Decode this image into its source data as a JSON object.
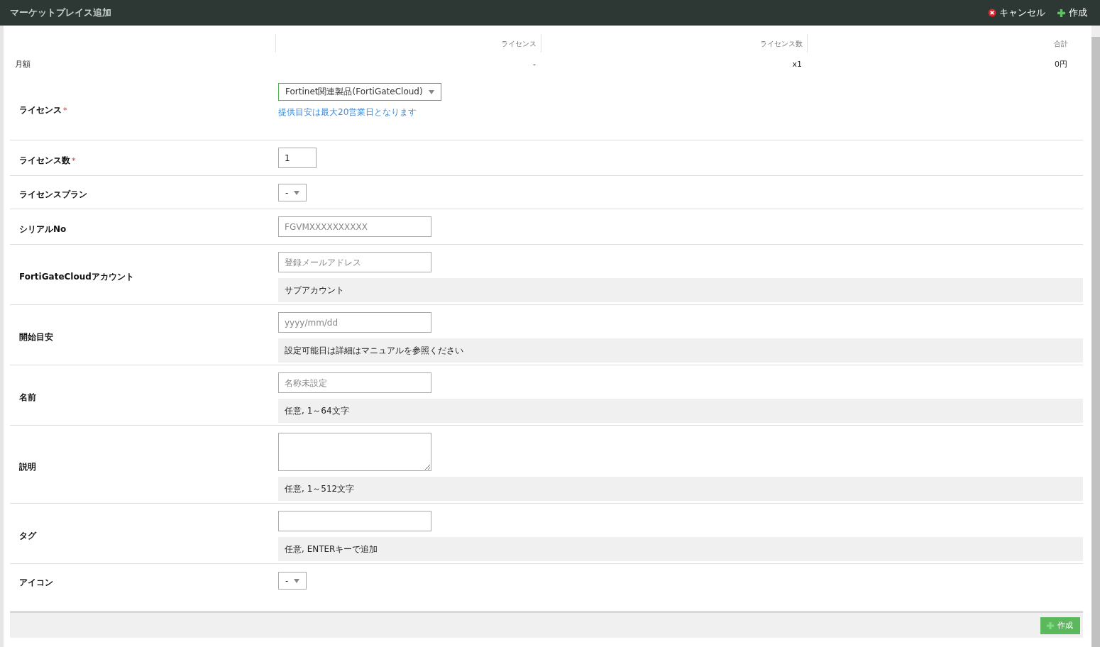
{
  "window": {
    "title": "マーケットプレイス追加"
  },
  "header_actions": [
    {
      "kind": "cancel",
      "label": "キャンセル"
    },
    {
      "kind": "create",
      "label": "作成"
    }
  ],
  "summary": {
    "row_label": "月額",
    "columns": [
      {
        "heading": "ライセンス",
        "value": "-"
      },
      {
        "heading": "ライセンス数",
        "value": "x1"
      },
      {
        "heading": "合計",
        "value": "0円"
      }
    ]
  },
  "form": [
    {
      "label": "ライセンス",
      "required_mark": "*",
      "control": {
        "kind": "select",
        "value": "Fortinet関連製品(FortiGateCloud)",
        "focused": true
      },
      "note": "提供目安は最大20営業日となります"
    },
    {
      "label": "ライセンス数",
      "required_mark": "*",
      "control": {
        "kind": "number",
        "value": "1"
      }
    },
    {
      "label": "ライセンスプラン",
      "control": {
        "kind": "select",
        "value": "-",
        "focused": false
      }
    },
    {
      "label": "シリアルNo",
      "control": {
        "kind": "text",
        "placeholder": "FGVMXXXXXXXXXX"
      }
    },
    {
      "label": "FortiGateCloudアカウント",
      "control": {
        "kind": "text",
        "placeholder": "登録メールアドレス"
      },
      "help": "サブアカウント"
    },
    {
      "label": "開始目安",
      "control": {
        "kind": "text",
        "placeholder": "yyyy/mm/dd"
      },
      "help": "設定可能日は詳細はマニュアルを参照ください"
    },
    {
      "label": "名前",
      "control": {
        "kind": "text",
        "placeholder": "名称未設定"
      },
      "help": "任意, 1～64文字"
    },
    {
      "label": "説明",
      "control": {
        "kind": "textarea"
      },
      "help": "任意, 1～512文字"
    },
    {
      "label": "タグ",
      "control": {
        "kind": "text"
      },
      "help": "任意, ENTERキーで追加"
    },
    {
      "label": "アイコン",
      "control": {
        "kind": "select",
        "value": "-",
        "focused": false
      }
    }
  ],
  "footer": {
    "button": "作成"
  }
}
